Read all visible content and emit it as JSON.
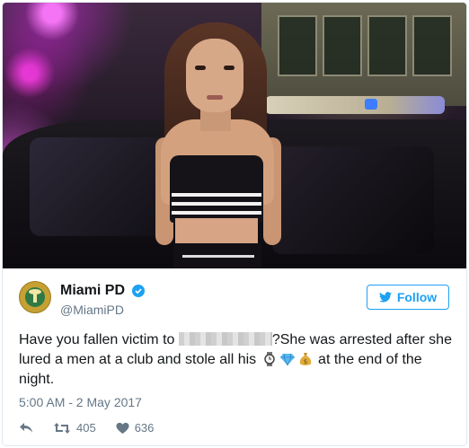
{
  "tweet": {
    "display_name": "Miami PD",
    "handle": "@MiamiPD",
    "follow_label": "Follow",
    "text_part1": "Have you fallen victim to ",
    "text_part2": "?She was arrested after she lured a men at a club and stole all his ",
    "text_part3": " at the end of the night.",
    "timestamp": "5:00 AM - 2 May 2017",
    "retweets": "405",
    "likes": "636"
  },
  "icons": {
    "verified": "verified-badge-icon",
    "follow": "twitter-bird-icon",
    "reply": "reply-icon",
    "retweet": "retweet-icon",
    "like": "heart-icon",
    "emojis": [
      "watch-icon",
      "gem-icon",
      "money-bag-icon"
    ]
  },
  "colors": {
    "accent": "#1da1f2",
    "text": "#14171a",
    "muted": "#657786",
    "border": "#e1e8ed"
  }
}
